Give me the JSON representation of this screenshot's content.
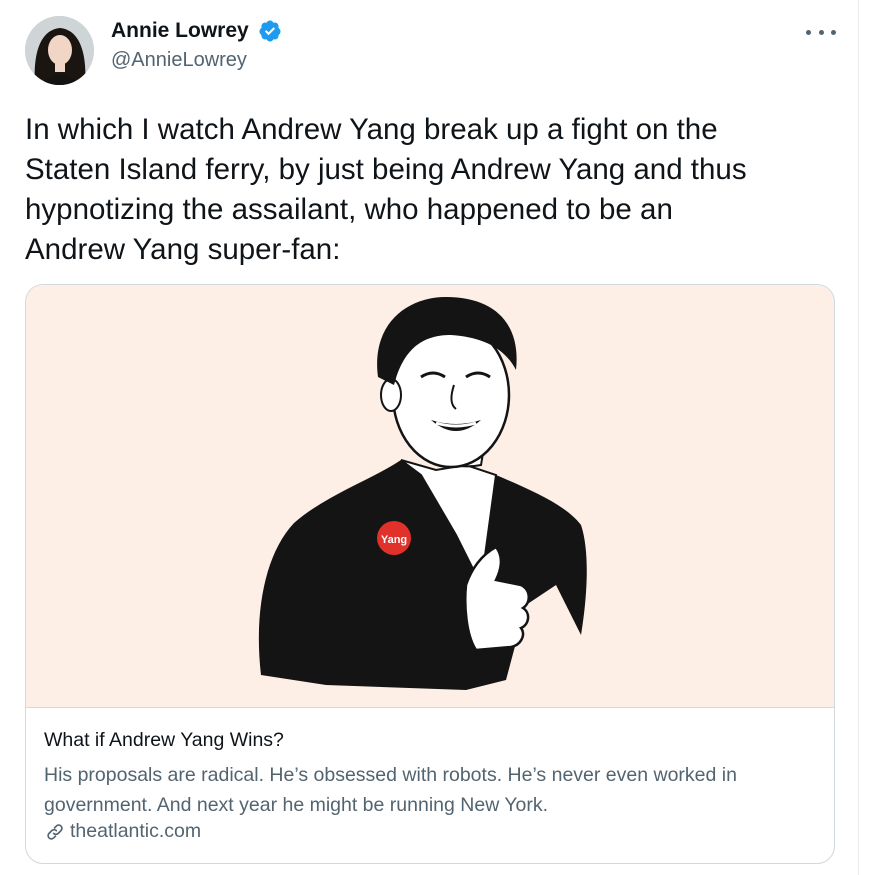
{
  "tweet": {
    "author_name": "Annie Lowrey",
    "author_handle": "@AnnieLowrey",
    "verified": true,
    "text": "In which I watch Andrew Yang break up a fight on the\nStaten Island ferry, by just being Andrew Yang and thus\nhypnotizing the assailant, who happened to be an\nAndrew Yang super-fan:"
  },
  "card": {
    "title": "What if Andrew Yang Wins?",
    "description": "His proposals are radical. He’s obsessed with robots. He’s never even worked in government. And next year he might be running New York.",
    "domain": "theatlantic.com",
    "badge_text": "Yang"
  },
  "colors": {
    "verified": "#1d9bf0",
    "card_image_bg": "#fdeee6",
    "secondary_text": "#536471"
  },
  "icons": {
    "verified": "verified-badge-icon",
    "more": "more-options-icon",
    "link": "link-icon"
  }
}
